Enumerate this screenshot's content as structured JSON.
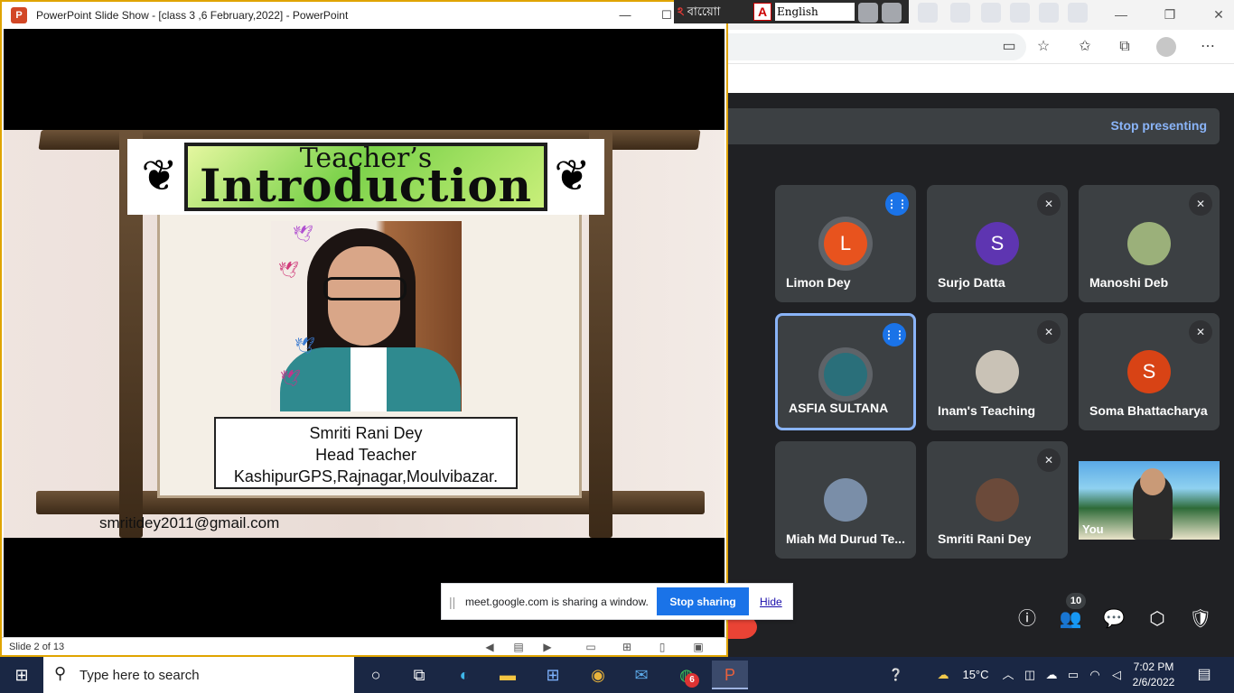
{
  "browser": {
    "window_controls": [
      "—",
      "❐",
      "✕"
    ],
    "toolbar_icons": [
      "video-camera-icon",
      "add-favorite-icon",
      "favorites-icon",
      "collections-icon",
      "profile-icon",
      "more-icon"
    ]
  },
  "meet": {
    "stop_presenting": "Stop presenting",
    "participants": [
      {
        "name": "Limon Dey",
        "initial": "L",
        "color": "#e8531e",
        "mic": "speaking",
        "photo": false
      },
      {
        "name": "Surjo Datta",
        "initial": "S",
        "color": "#5e35b1",
        "mic": "muted",
        "photo": false
      },
      {
        "name": "Manoshi Deb",
        "initial": "",
        "color": "#9bb07a",
        "mic": "muted",
        "photo": true
      },
      {
        "name": "ASFIA SULTANA",
        "initial": "",
        "color": "#2a6f7a",
        "mic": "speaking",
        "photo": true
      },
      {
        "name": "Inam's Teaching",
        "initial": "",
        "color": "#c9c2b6",
        "mic": "muted",
        "photo": true
      },
      {
        "name": "Soma Bhattacharya",
        "initial": "S",
        "color": "#d84315",
        "mic": "muted",
        "photo": false
      },
      {
        "name": "Miah Md Durud Te...",
        "initial": "",
        "color": "#7a8ea8",
        "mic": "none",
        "photo": true
      },
      {
        "name": "Smriti Rani Dey",
        "initial": "",
        "color": "#6b4a3a",
        "mic": "muted",
        "photo": true
      }
    ],
    "self_label": "You",
    "people_count": "10"
  },
  "ppt": {
    "window_title": "PowerPoint Slide Show - [class 3 ,6 February,2022] - PowerPoint",
    "slide_title_small": "Teacher’s",
    "slide_title_big": "Introduction",
    "teacher_name": "Smriti Rani Dey",
    "teacher_role": "Head Teacher",
    "teacher_school": "KashipurGPS,Rajnagar,Moulvibazar.",
    "email": "smritidey2011@gmail.com",
    "slide_status": "Slide 2 of 13"
  },
  "langbar": {
    "bangla": "বায়োো",
    "english": "English"
  },
  "share": {
    "message": "meet.google.com is sharing a window.",
    "stop_label": "Stop sharing",
    "hide_label": "Hide"
  },
  "taskbar": {
    "search_placeholder": "Type here to search",
    "temperature": "15°C",
    "time": "7:02 PM",
    "date": "2/6/2022",
    "whatsapp_badge": "6"
  }
}
